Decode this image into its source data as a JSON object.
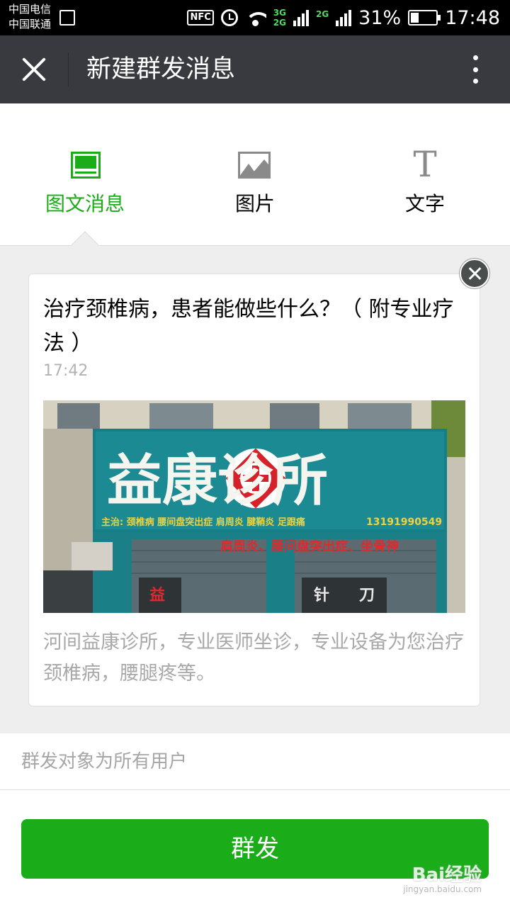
{
  "status_bar": {
    "carrier_1": "中国电信",
    "carrier_2": "中国联通",
    "nfc": "NFC",
    "net_top": "3G",
    "net_bottom": "2G",
    "net_2": "2G",
    "battery": "31%",
    "time": "17:48"
  },
  "header": {
    "title": "新建群发消息",
    "close_icon": "close-icon",
    "more_icon": "more-vertical-icon"
  },
  "tabs": [
    {
      "label": "图文消息",
      "icon": "news-icon",
      "active": true
    },
    {
      "label": "图片",
      "icon": "image-icon",
      "active": false
    },
    {
      "label": "文字",
      "icon": "text-icon",
      "glyph": "T",
      "active": false
    }
  ],
  "article": {
    "title": "治疗颈椎病，患者能做些什么？（ 附专业疗法 ）",
    "time": "17:42",
    "cover": {
      "sign_text": "益康诊所",
      "sign_line": "主治: 颈椎病 腰间盘突出症 肩周炎 腱鞘炎 足跟痛",
      "phone": "13191990549",
      "lower_sign": "肩周炎、腰间盘突出症、坐骨神",
      "door_1": "益",
      "door_2": "针",
      "door_3": "刀"
    },
    "description": "河间益康诊所，专业医师坐诊，专业设备为您治疗颈椎病，腰腿疼等。"
  },
  "target": {
    "text": "群发对象为所有用户"
  },
  "send_button": {
    "label": "群发"
  },
  "watermark": {
    "brand": "Bai经验",
    "url": "jingyan.baidu.com"
  },
  "colors": {
    "accent": "#1aad19",
    "titlebar": "#393a3f",
    "statusbar": "#000000",
    "content_bg": "#eeeeee"
  }
}
